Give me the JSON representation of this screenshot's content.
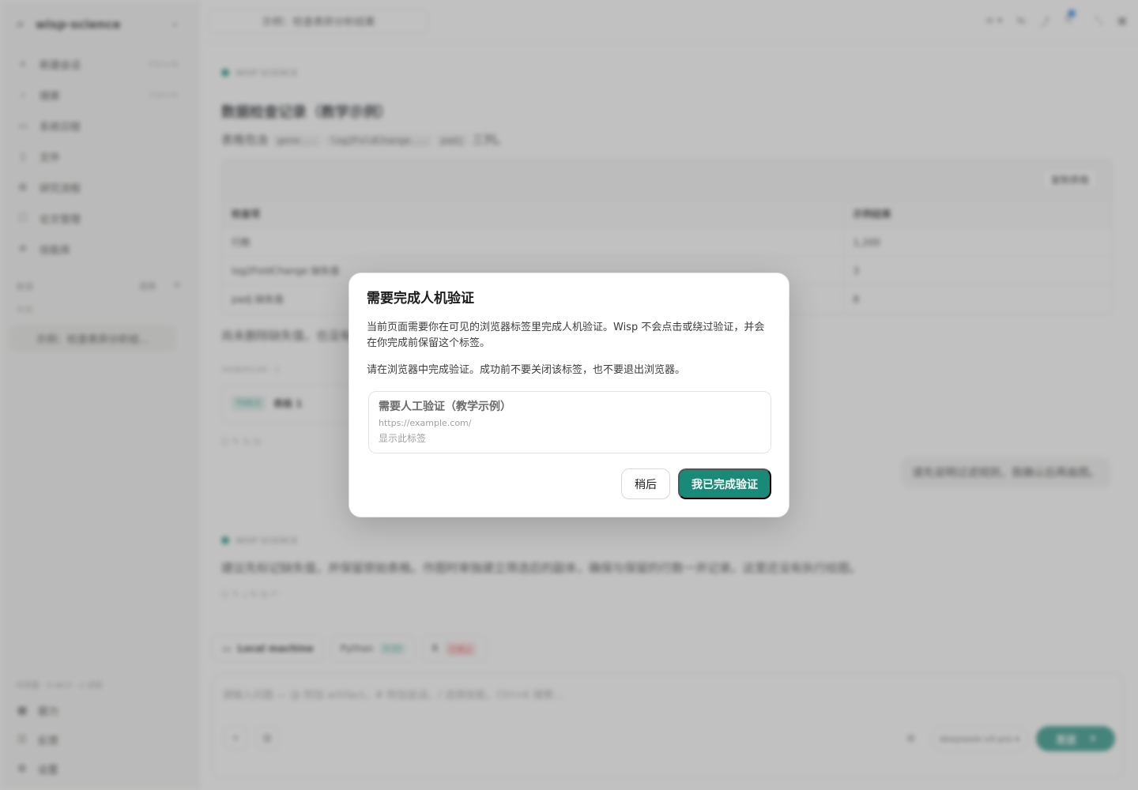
{
  "sidebar": {
    "brand": "wisp-science",
    "menu_icon": "≡",
    "collapse_icon": "«",
    "items": [
      {
        "icon": "+",
        "label": "新建会话",
        "kbd": "Ctrl+N"
      },
      {
        "icon": "⌕",
        "label": "搜索",
        "kbd": "Ctrl+K"
      },
      {
        "icon": "▭",
        "label": "系统日程",
        "kbd": ""
      },
      {
        "icon": "▯",
        "label": "文件",
        "kbd": ""
      },
      {
        "icon": "⊠",
        "label": "研究流程",
        "kbd": ""
      },
      {
        "icon": "☐",
        "label": "论文管理",
        "kbd": ""
      },
      {
        "icon": "✲",
        "label": "技能库",
        "kbd": ""
      }
    ],
    "section_label": "会话",
    "section_right_1": "选择",
    "section_right_2": "≡",
    "group_label": "今天",
    "active_session": "示例：检查表异分析结...",
    "status_line": "可用量 · 5 MCP · 2 进程",
    "bottom_items": [
      {
        "icon": "▦",
        "label": "额力"
      },
      {
        "icon": "☷",
        "label": "反馈"
      },
      {
        "icon": "⚙",
        "label": "设置"
      }
    ]
  },
  "topbar": {
    "tab_title": "示例：检查表异分析结果",
    "icons": [
      "≡ ▾",
      "⇆",
      "⤴",
      "✎",
      "⤡",
      "▣"
    ]
  },
  "conversation": {
    "agent_name": "WISP SCIENCE",
    "title": "数据检查记录（教学示例）",
    "sub_prefix": "表格包含",
    "code_1": "gene...",
    "code_2": "log2FoldChange...",
    "code_3": "padj",
    "sub_suffix": "三列。",
    "copy_button": "复制表格",
    "table": {
      "headers": [
        "检查项",
        "示例结果"
      ],
      "rows": [
        [
          "行数",
          "1,200"
        ],
        [
          "log2FoldChange 缺失值",
          "3"
        ],
        [
          "padj 缺失值",
          "8"
        ]
      ]
    },
    "note": "尚未删除缺失值，也没有修改原始数据。",
    "meta": "2026/01/20 · 1",
    "file_tag": "TABLE",
    "file_name": "表格 1",
    "action_icons": "⎘  ✎  ↻  ⧉",
    "user_message": "请先说明过滤规则，我确认后再画图。",
    "reply_agent": "WISP SCIENCE",
    "reply_text": "建议先标记缺失值，并保留原始表格。作图时单独建立筛选后的副本，确保与保留的行数一并记录。这里还没有执行绘图。",
    "reply_actions": "⎘  ✎  ⤓  ↻  ⧉  ↶"
  },
  "composer": {
    "chip_machine": "Local machine",
    "chip_python": "Python",
    "chip_python_status": "3.12",
    "chip_r": "R",
    "chip_r_status": "已禁止",
    "placeholder": "请输入问题 — @ 附加 artifact，# 附加会话，/ 选择技能，Ctrl+K 搜索...",
    "attach": "+",
    "mention": "@",
    "gear": "⚙",
    "model": "deepseek-v4-pro ▾",
    "send": "发送",
    "send_caret": "▾"
  },
  "modal": {
    "title": "需要完成人机验证",
    "body": "当前页面需要你在可见的浏览器标签里完成人机验证。Wisp 不会点击或绕过验证，并会在你完成前保留这个标签。",
    "body2": "请在浏览器中完成验证。成功前不要关闭该标签，也不要退出浏览器。",
    "tab_title": "需要人工验证（教学示例）",
    "tab_url": "https://example.com/",
    "tab_link": "显示此标签",
    "later_button": "稍后",
    "done_button": "我已完成验证"
  },
  "colors": {
    "accent": "#1a8a78",
    "overlay": "rgba(120,120,120,0.46)"
  }
}
